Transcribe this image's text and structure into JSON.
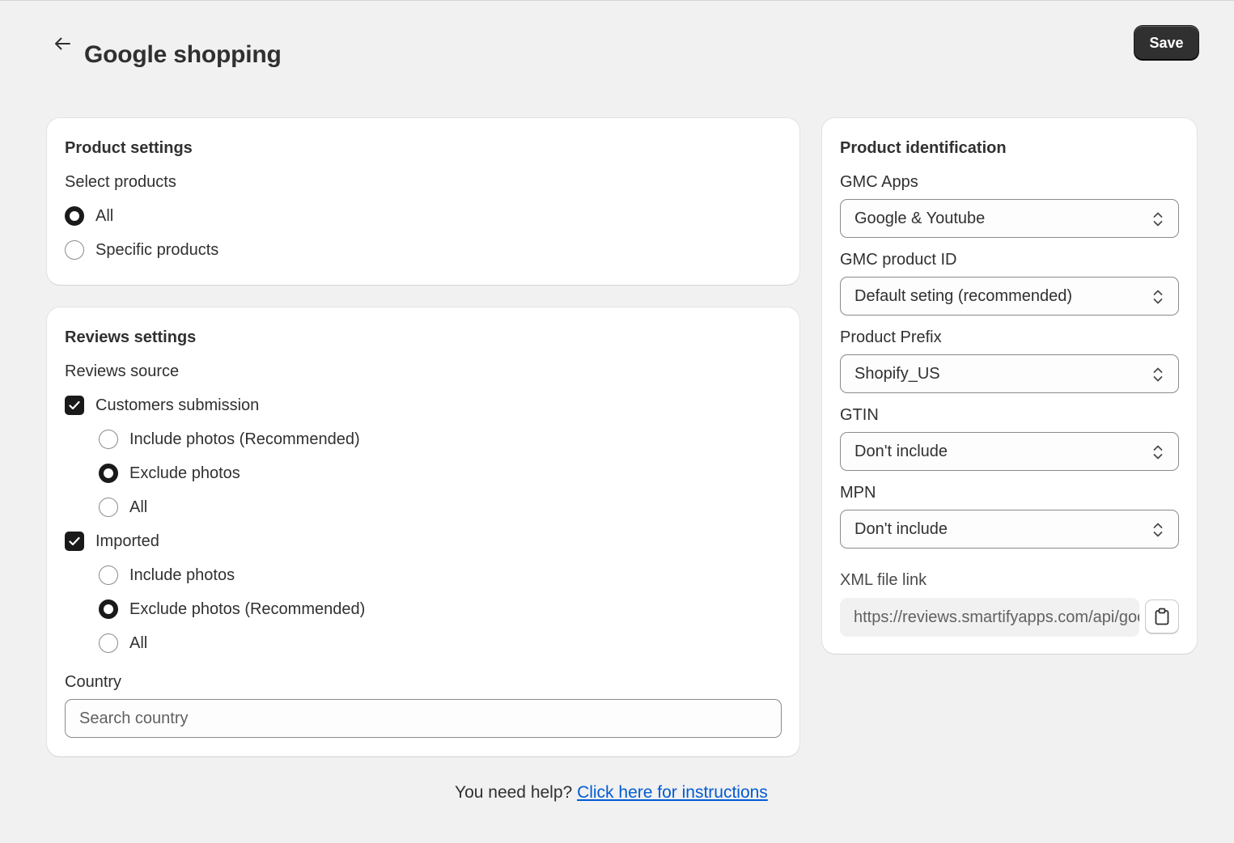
{
  "header": {
    "title": "Google shopping",
    "save_label": "Save",
    "back_icon": "arrow-left-icon"
  },
  "product_settings": {
    "title": "Product settings",
    "select_label": "Select products",
    "options": [
      {
        "label": "All",
        "selected": true
      },
      {
        "label": "Specific products",
        "selected": false
      }
    ]
  },
  "reviews_settings": {
    "title": "Reviews settings",
    "source_label": "Reviews source",
    "customers": {
      "label": "Customers submission",
      "checked": true,
      "options": [
        {
          "label": "Include photos (Recommended)",
          "selected": false
        },
        {
          "label": "Exclude photos",
          "selected": true
        },
        {
          "label": "All",
          "selected": false
        }
      ]
    },
    "imported": {
      "label": "Imported",
      "checked": true,
      "options": [
        {
          "label": "Include photos",
          "selected": false
        },
        {
          "label": "Exclude photos (Recommended)",
          "selected": true
        },
        {
          "label": "All",
          "selected": false
        }
      ]
    },
    "country_label": "Country",
    "country_placeholder": "Search country"
  },
  "product_identification": {
    "title": "Product identification",
    "fields": [
      {
        "label": "GMC Apps",
        "value": "Google & Youtube"
      },
      {
        "label": "GMC product ID",
        "value": "Default seting (recommended)"
      },
      {
        "label": "Product Prefix",
        "value": "Shopify_US"
      },
      {
        "label": "GTIN",
        "value": "Don't include"
      },
      {
        "label": "MPN",
        "value": "Don't include"
      }
    ],
    "xml_label": "XML file link",
    "xml_value": "https://reviews.smartifyapps.com/api/google-shopping/feed.xml",
    "copy_icon": "clipboard-icon"
  },
  "footer": {
    "help_text": "You need help?",
    "help_link": "Click here for instructions"
  },
  "colors": {
    "background": "#f1f1f1",
    "card": "#ffffff",
    "primary_button": "#303030",
    "link": "#005bd3"
  }
}
